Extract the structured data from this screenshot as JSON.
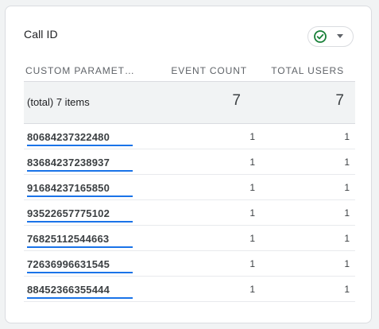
{
  "card": {
    "title": "Call ID"
  },
  "status": {
    "icon": "check-circle-icon",
    "color": "#188038"
  },
  "table": {
    "headers": [
      "CUSTOM PARAMET…",
      "EVENT COUNT",
      "TOTAL USERS"
    ],
    "total": {
      "label": "(total) 7 items",
      "event_count": "7",
      "total_users": "7"
    },
    "rows": [
      {
        "id": "80684237322480",
        "event_count": "1",
        "total_users": "1",
        "share": 1.0
      },
      {
        "id": "83684237238937",
        "event_count": "1",
        "total_users": "1",
        "share": 1.0
      },
      {
        "id": "91684237165850",
        "event_count": "1",
        "total_users": "1",
        "share": 1.0
      },
      {
        "id": "93522657775102",
        "event_count": "1",
        "total_users": "1",
        "share": 1.0
      },
      {
        "id": "76825112544663",
        "event_count": "1",
        "total_users": "1",
        "share": 1.0
      },
      {
        "id": "72636996631545",
        "event_count": "1",
        "total_users": "1",
        "share": 1.0
      },
      {
        "id": "88452366355444",
        "event_count": "1",
        "total_users": "1",
        "share": 1.0
      }
    ],
    "bar_color": "#1a73e8"
  }
}
